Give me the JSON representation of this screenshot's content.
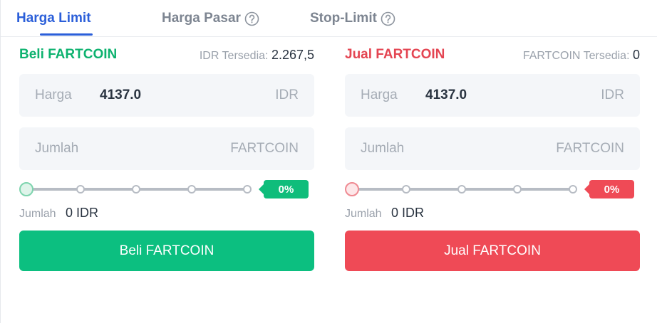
{
  "tabs": [
    {
      "label": "Harga Limit",
      "active": true
    },
    {
      "label": "Harga Pasar",
      "help_icon": "question-circle-icon"
    },
    {
      "label": "Stop-Limit",
      "help_icon": "question-circle-icon"
    }
  ],
  "buy": {
    "title": "Beli FARTCOIN",
    "available_label": "IDR Tersedia:",
    "available_value": "2.267,5",
    "price_label": "Harga",
    "price_value": "4137.0",
    "price_unit": "IDR",
    "amount_label": "Jumlah",
    "amount_unit": "FARTCOIN",
    "slider_percent_label": "0%",
    "slider_value": 0,
    "total_label": "Jumlah",
    "total_value": "0 IDR",
    "button_label": "Beli FARTCOIN",
    "color": "#0cbf80"
  },
  "sell": {
    "title": "Jual FARTCOIN",
    "available_label": "FARTCOIN Tersedia:",
    "available_value": "0",
    "price_label": "Harga",
    "price_value": "4137.0",
    "price_unit": "IDR",
    "amount_label": "Jumlah",
    "amount_unit": "FARTCOIN",
    "slider_percent_label": "0%",
    "slider_value": 0,
    "total_label": "Jumlah",
    "total_value": "0 IDR",
    "button_label": "Jual FARTCOIN",
    "color": "#ef4a56"
  },
  "accent_color": "#2b5fd9"
}
